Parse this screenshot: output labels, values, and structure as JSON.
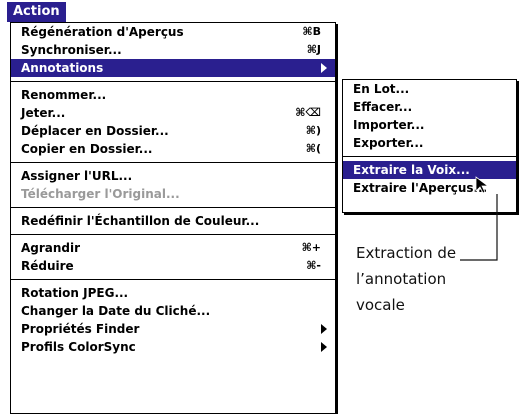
{
  "menubar": {
    "label": "Action"
  },
  "main_menu": {
    "groups": [
      [
        {
          "label": "Régénération d'Aperçus",
          "shortcut": "⌘B"
        },
        {
          "label": "Synchroniser...",
          "shortcut": "⌘J"
        },
        {
          "label": "Annotations",
          "submenu": true,
          "highlighted": true
        }
      ],
      [
        {
          "label": "Renommer..."
        },
        {
          "label": "Jeter...",
          "shortcut": "⌘⌫"
        },
        {
          "label": "Déplacer en Dossier...",
          "shortcut": "⌘)"
        },
        {
          "label": "Copier en Dossier...",
          "shortcut": "⌘("
        }
      ],
      [
        {
          "label": "Assigner l'URL..."
        },
        {
          "label": "Télécharger l'Original...",
          "disabled": true
        }
      ],
      [
        {
          "label": "Redéfinir l'Échantillon de Couleur..."
        }
      ],
      [
        {
          "label": "Agrandir",
          "shortcut": "⌘+"
        },
        {
          "label": "Réduire",
          "shortcut": "⌘-"
        }
      ],
      [
        {
          "label": "Rotation JPEG..."
        },
        {
          "label": "Changer la Date du Cliché..."
        },
        {
          "label": "Propriétés Finder",
          "submenu": true
        },
        {
          "label": "Profils ColorSync",
          "submenu": true
        }
      ]
    ]
  },
  "submenu": {
    "groups": [
      [
        {
          "label": "En Lot..."
        },
        {
          "label": "Effacer..."
        },
        {
          "label": "Importer..."
        },
        {
          "label": "Exporter..."
        }
      ],
      [
        {
          "label": "Extraire la Voix...",
          "highlighted": true
        },
        {
          "label": "Extraire l'Aperçus..."
        }
      ]
    ]
  },
  "callout": {
    "text_line1": "Extraction de",
    "text_line2": "l’annotation",
    "text_line3": "vocale"
  },
  "colors": {
    "highlight": "#2a1f8f",
    "disabled_text": "#9a9a9a"
  },
  "icons": {
    "cursor": "arrow-cursor-icon"
  }
}
